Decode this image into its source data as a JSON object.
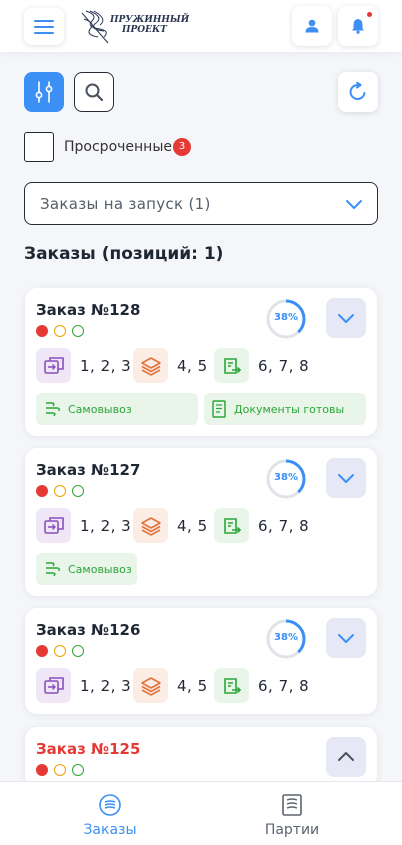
{
  "app": {
    "logo_line1": "ПРУЖИННЫЙ",
    "logo_line2": "ПРОЕКТ"
  },
  "icons": {
    "menu": "hamburger-icon",
    "user": "user-icon",
    "bell": "bell-icon",
    "filter": "sliders-icon",
    "search": "search-icon",
    "refresh": "refresh-icon",
    "chevron": "chevron-down-icon"
  },
  "colors": {
    "accent": "#3b8ff5",
    "danger": "#e53935",
    "success": "#2aa63a",
    "warning": "#f0a000"
  },
  "filters": {
    "overdue_label": "Просроченные",
    "overdue_count": "3",
    "select_value": "Заказы на запуск (1)"
  },
  "section_title": "Заказы (позиций: 1)",
  "orders": [
    {
      "title": "Заказ №128",
      "progress": "38%",
      "progress_value": 0.38,
      "expanded": false,
      "groups": [
        "1, 2, 3",
        "4, 5",
        "6, 7, 8"
      ],
      "tags": [
        "Самовывоз",
        "Документы готовы"
      ]
    },
    {
      "title": "Заказ №127",
      "progress": "38%",
      "progress_value": 0.38,
      "expanded": false,
      "groups": [
        "1, 2, 3",
        "4, 5",
        "6, 7, 8"
      ],
      "tags": [
        "Самовывоз"
      ]
    },
    {
      "title": "Заказ №126",
      "progress": "38%",
      "progress_value": 0.38,
      "expanded": false,
      "groups": [
        "1, 2, 3",
        "4, 5",
        "6, 7, 8"
      ],
      "tags": []
    },
    {
      "title": "Заказ №125",
      "expanded": true,
      "highlight": "red"
    }
  ],
  "nav": [
    {
      "label": "Заказы",
      "active": true,
      "icon": "orders-icon"
    },
    {
      "label": "Партии",
      "active": false,
      "icon": "batches-icon"
    }
  ]
}
